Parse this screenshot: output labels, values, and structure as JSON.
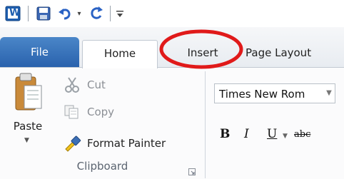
{
  "quick_access": {
    "app_icon_letter": "W",
    "items": [
      "save-icon",
      "undo-icon",
      "undo-dropdown-icon",
      "redo-icon",
      "customize-icon"
    ]
  },
  "tabs": [
    {
      "label": "File",
      "active": false
    },
    {
      "label": "Home",
      "active": true
    },
    {
      "label": "Insert",
      "active": false
    },
    {
      "label": "Page Layout",
      "active": false
    }
  ],
  "clipboard": {
    "paste_label": "Paste",
    "cut_label": "Cut",
    "copy_label": "Copy",
    "format_painter_label": "Format Painter",
    "group_label": "Clipboard"
  },
  "font": {
    "font_name": "Times New Rom",
    "bold": "B",
    "italic": "I",
    "underline": "U",
    "strike": "abc"
  },
  "colors": {
    "file_tab": "#2b63ad",
    "annotation": "#e01a1a"
  }
}
